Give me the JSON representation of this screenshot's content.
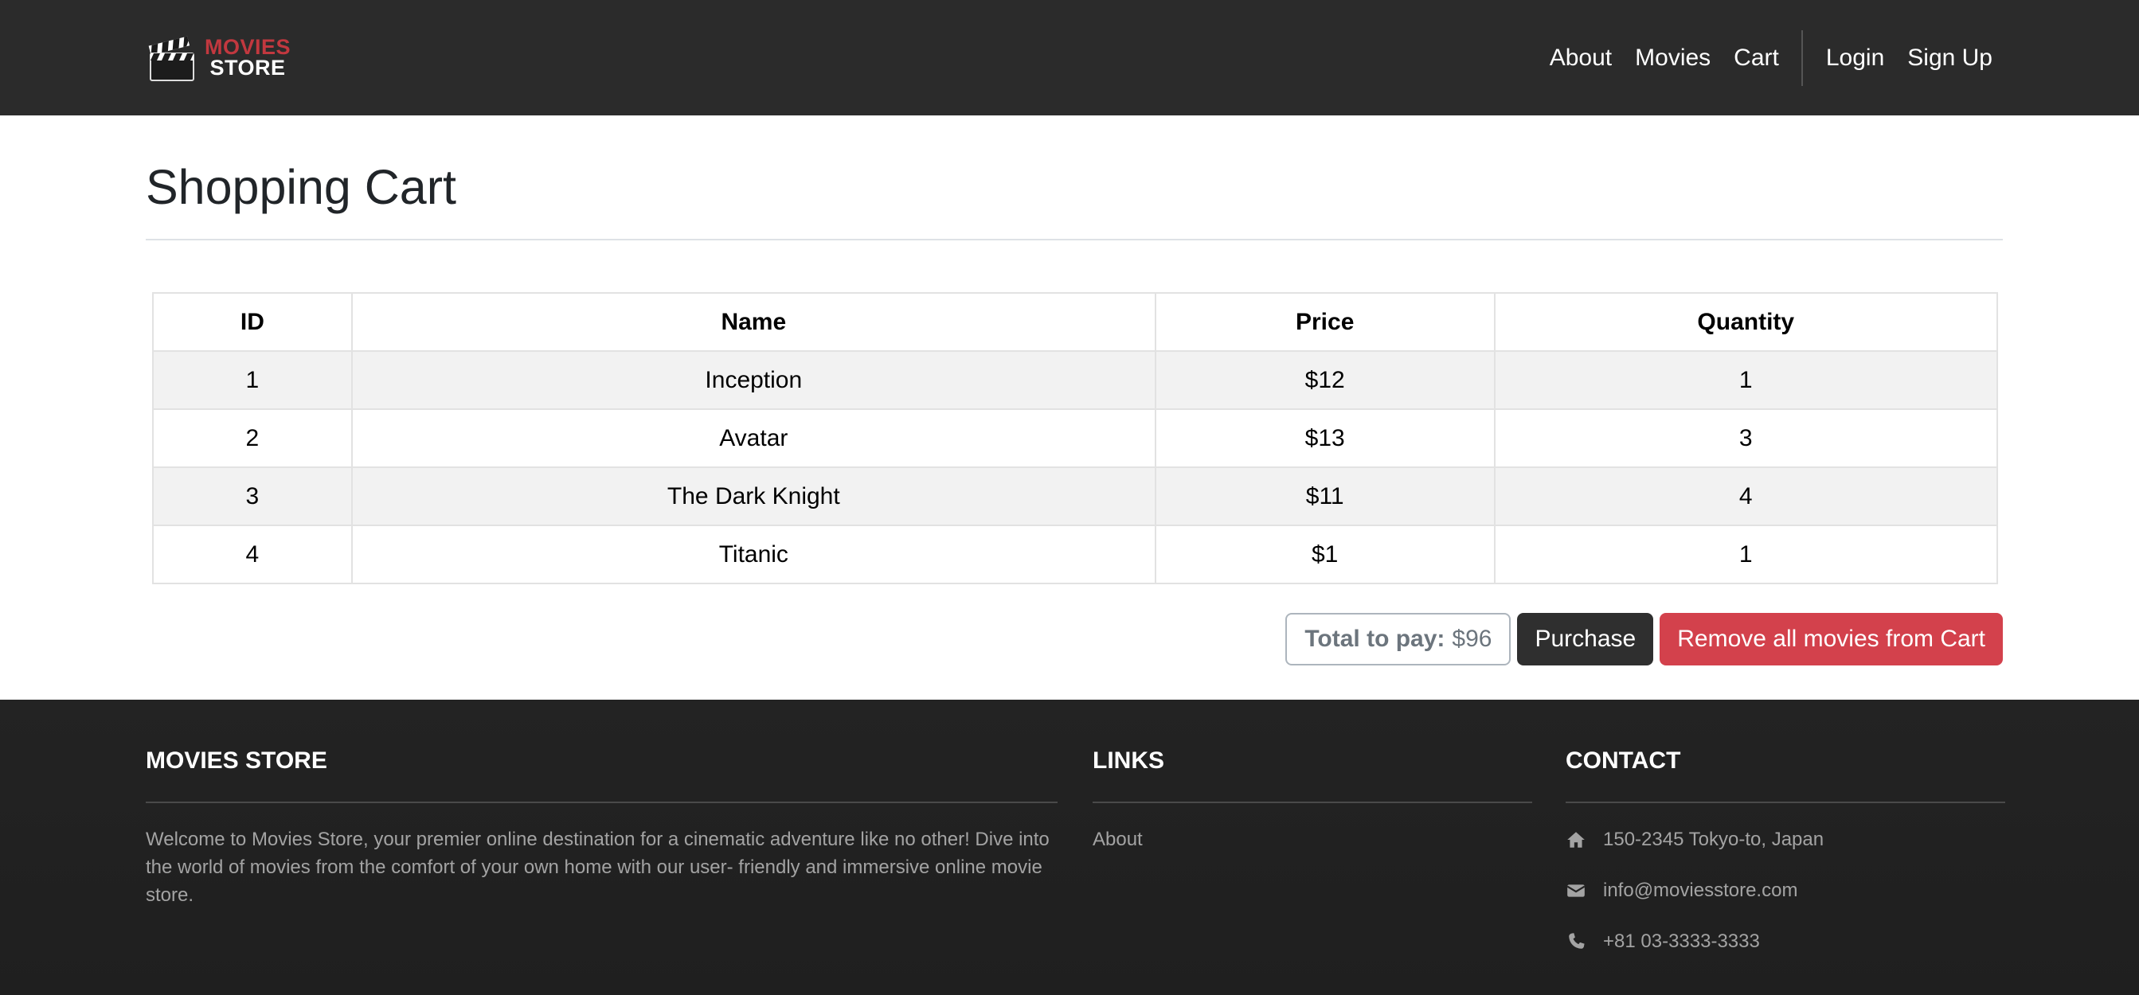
{
  "brand": {
    "line1": "MOVIES",
    "line2": "STORE",
    "icon": "clapperboard-icon",
    "accent": "#c2383f"
  },
  "nav": {
    "about": "About",
    "movies": "Movies",
    "cart": "Cart",
    "login": "Login",
    "signup": "Sign Up"
  },
  "page": {
    "title": "Shopping Cart"
  },
  "table": {
    "headers": [
      "ID",
      "Name",
      "Price",
      "Quantity"
    ],
    "rows": [
      [
        "1",
        "Inception",
        "$12",
        "1"
      ],
      [
        "2",
        "Avatar",
        "$13",
        "3"
      ],
      [
        "3",
        "The Dark Knight",
        "$11",
        "4"
      ],
      [
        "4",
        "Titanic",
        "$1",
        "1"
      ]
    ]
  },
  "summary": {
    "total_label": "Total to pay:",
    "total_value": "$96",
    "purchase_label": "Purchase",
    "remove_all_label": "Remove all movies from Cart"
  },
  "footer": {
    "about_heading": "MOVIES STORE",
    "about_text": "Welcome to Movies Store, your premier online destination for a cinematic adventure like no other! Dive into the world of movies from the comfort of your own home with our user- friendly and immersive online movie store.",
    "links_heading": "LINKS",
    "links": [
      "About"
    ],
    "contact_heading": "CONTACT",
    "address": "150-2345 Tokyo-to, Japan",
    "email": "info@moviesstore.com",
    "phone": "+81 03-3333-3333"
  },
  "colors": {
    "navbar": "#2b2b2b",
    "danger": "#d3414c",
    "dark_button": "#2f2f2f",
    "footer": "#232323"
  }
}
